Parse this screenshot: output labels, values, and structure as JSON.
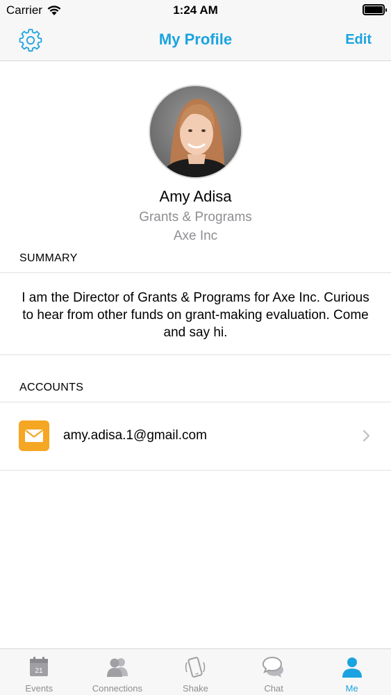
{
  "status_bar": {
    "carrier": "Carrier",
    "time": "1:24 AM"
  },
  "nav": {
    "title": "My Profile",
    "edit_label": "Edit",
    "settings_icon": "gear-icon"
  },
  "profile": {
    "name": "Amy Adisa",
    "role": "Grants & Programs",
    "company": "Axe Inc"
  },
  "summary": {
    "header": "SUMMARY",
    "text": "I am the Director of Grants & Programs for Axe Inc. Curious to hear from other funds on grant-making evaluation. Come and say hi."
  },
  "accounts": {
    "header": "ACCOUNTS",
    "items": [
      {
        "icon": "mail-icon",
        "email": "amy.adisa.1@gmail.com"
      }
    ]
  },
  "tab_bar": {
    "tabs": [
      {
        "label": "Events",
        "icon": "calendar-icon",
        "calendar_day": "21"
      },
      {
        "label": "Connections",
        "icon": "people-icon"
      },
      {
        "label": "Shake",
        "icon": "shake-phone-icon"
      },
      {
        "label": "Chat",
        "icon": "chat-bubbles-icon"
      },
      {
        "label": "Me",
        "icon": "person-icon",
        "active": true
      }
    ]
  },
  "colors": {
    "accent": "#1aa3e0",
    "secondary_text": "#8e8e93",
    "mail_icon_bg": "#f5a623",
    "inactive_icon": "#a0a0a4"
  }
}
